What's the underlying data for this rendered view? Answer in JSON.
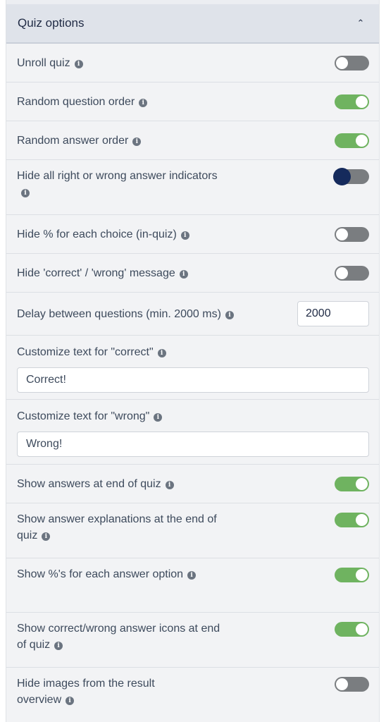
{
  "header": {
    "title": "Quiz options",
    "chevron_icon": "chevron-up-icon"
  },
  "options": {
    "unroll_quiz": {
      "label": "Unroll quiz",
      "state": "off"
    },
    "random_question_order": {
      "label": "Random question order",
      "state": "on"
    },
    "random_answer_order": {
      "label": "Random answer order",
      "state": "on"
    },
    "hide_indicators": {
      "label": "Hide all right or wrong answer indicators",
      "state": "off-focused"
    },
    "hide_percent_choice": {
      "label": "Hide % for each choice (in-quiz)",
      "state": "off"
    },
    "hide_correct_wrong_message": {
      "label": "Hide 'correct' / 'wrong' message",
      "state": "off"
    },
    "delay": {
      "label": "Delay between questions (min. 2000 ms)",
      "value": "2000"
    },
    "custom_correct": {
      "label": "Customize text for \"correct\"",
      "value": "Correct!"
    },
    "custom_wrong": {
      "label": "Customize text for \"wrong\"",
      "value": "Wrong!"
    },
    "show_answers_end": {
      "label": "Show answers at end of quiz",
      "state": "on"
    },
    "show_explanations_end": {
      "label": "Show answer explanations at the end of quiz",
      "state": "on"
    },
    "show_percent_option": {
      "label": "Show %'s for each answer option",
      "state": "on"
    },
    "show_icons_end": {
      "label": "Show correct/wrong answer icons at end of quiz",
      "state": "on"
    },
    "hide_images_result": {
      "label": "Hide images from the result overview",
      "state": "off"
    }
  },
  "colors": {
    "toggle_on": "#6fb360",
    "toggle_off": "#7a7d80",
    "focus_knob": "#152a5c",
    "header_bg": "#dfe3ea"
  }
}
